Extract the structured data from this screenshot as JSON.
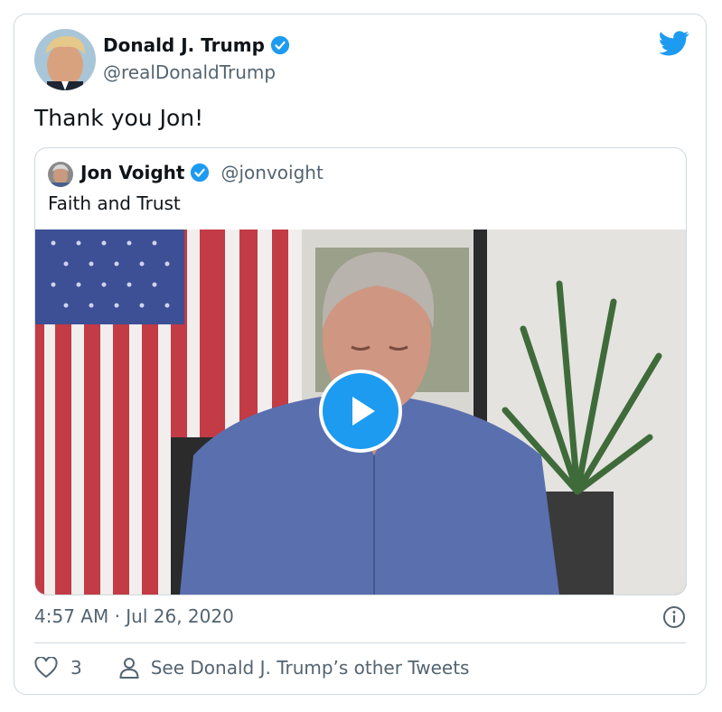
{
  "author": {
    "name": "Donald J. Trump",
    "handle": "@realDonaldTrump"
  },
  "tweet": {
    "text": "Thank you Jon!",
    "timestamp": "4:57 AM · Jul 26, 2020"
  },
  "quoted": {
    "name": "Jon Voight",
    "handle": "@jonvoight",
    "text": "Faith and Trust"
  },
  "footer": {
    "like_count": "3",
    "other_tweets_label": "See Donald J. Trump’s other Tweets"
  },
  "colors": {
    "accent": "#1d9bf0",
    "secondary_text": "#536471",
    "border": "#cfd9de"
  },
  "icons": [
    "twitter-logo-icon",
    "verified-badge-icon",
    "play-icon",
    "info-icon",
    "heart-icon",
    "person-icon"
  ]
}
